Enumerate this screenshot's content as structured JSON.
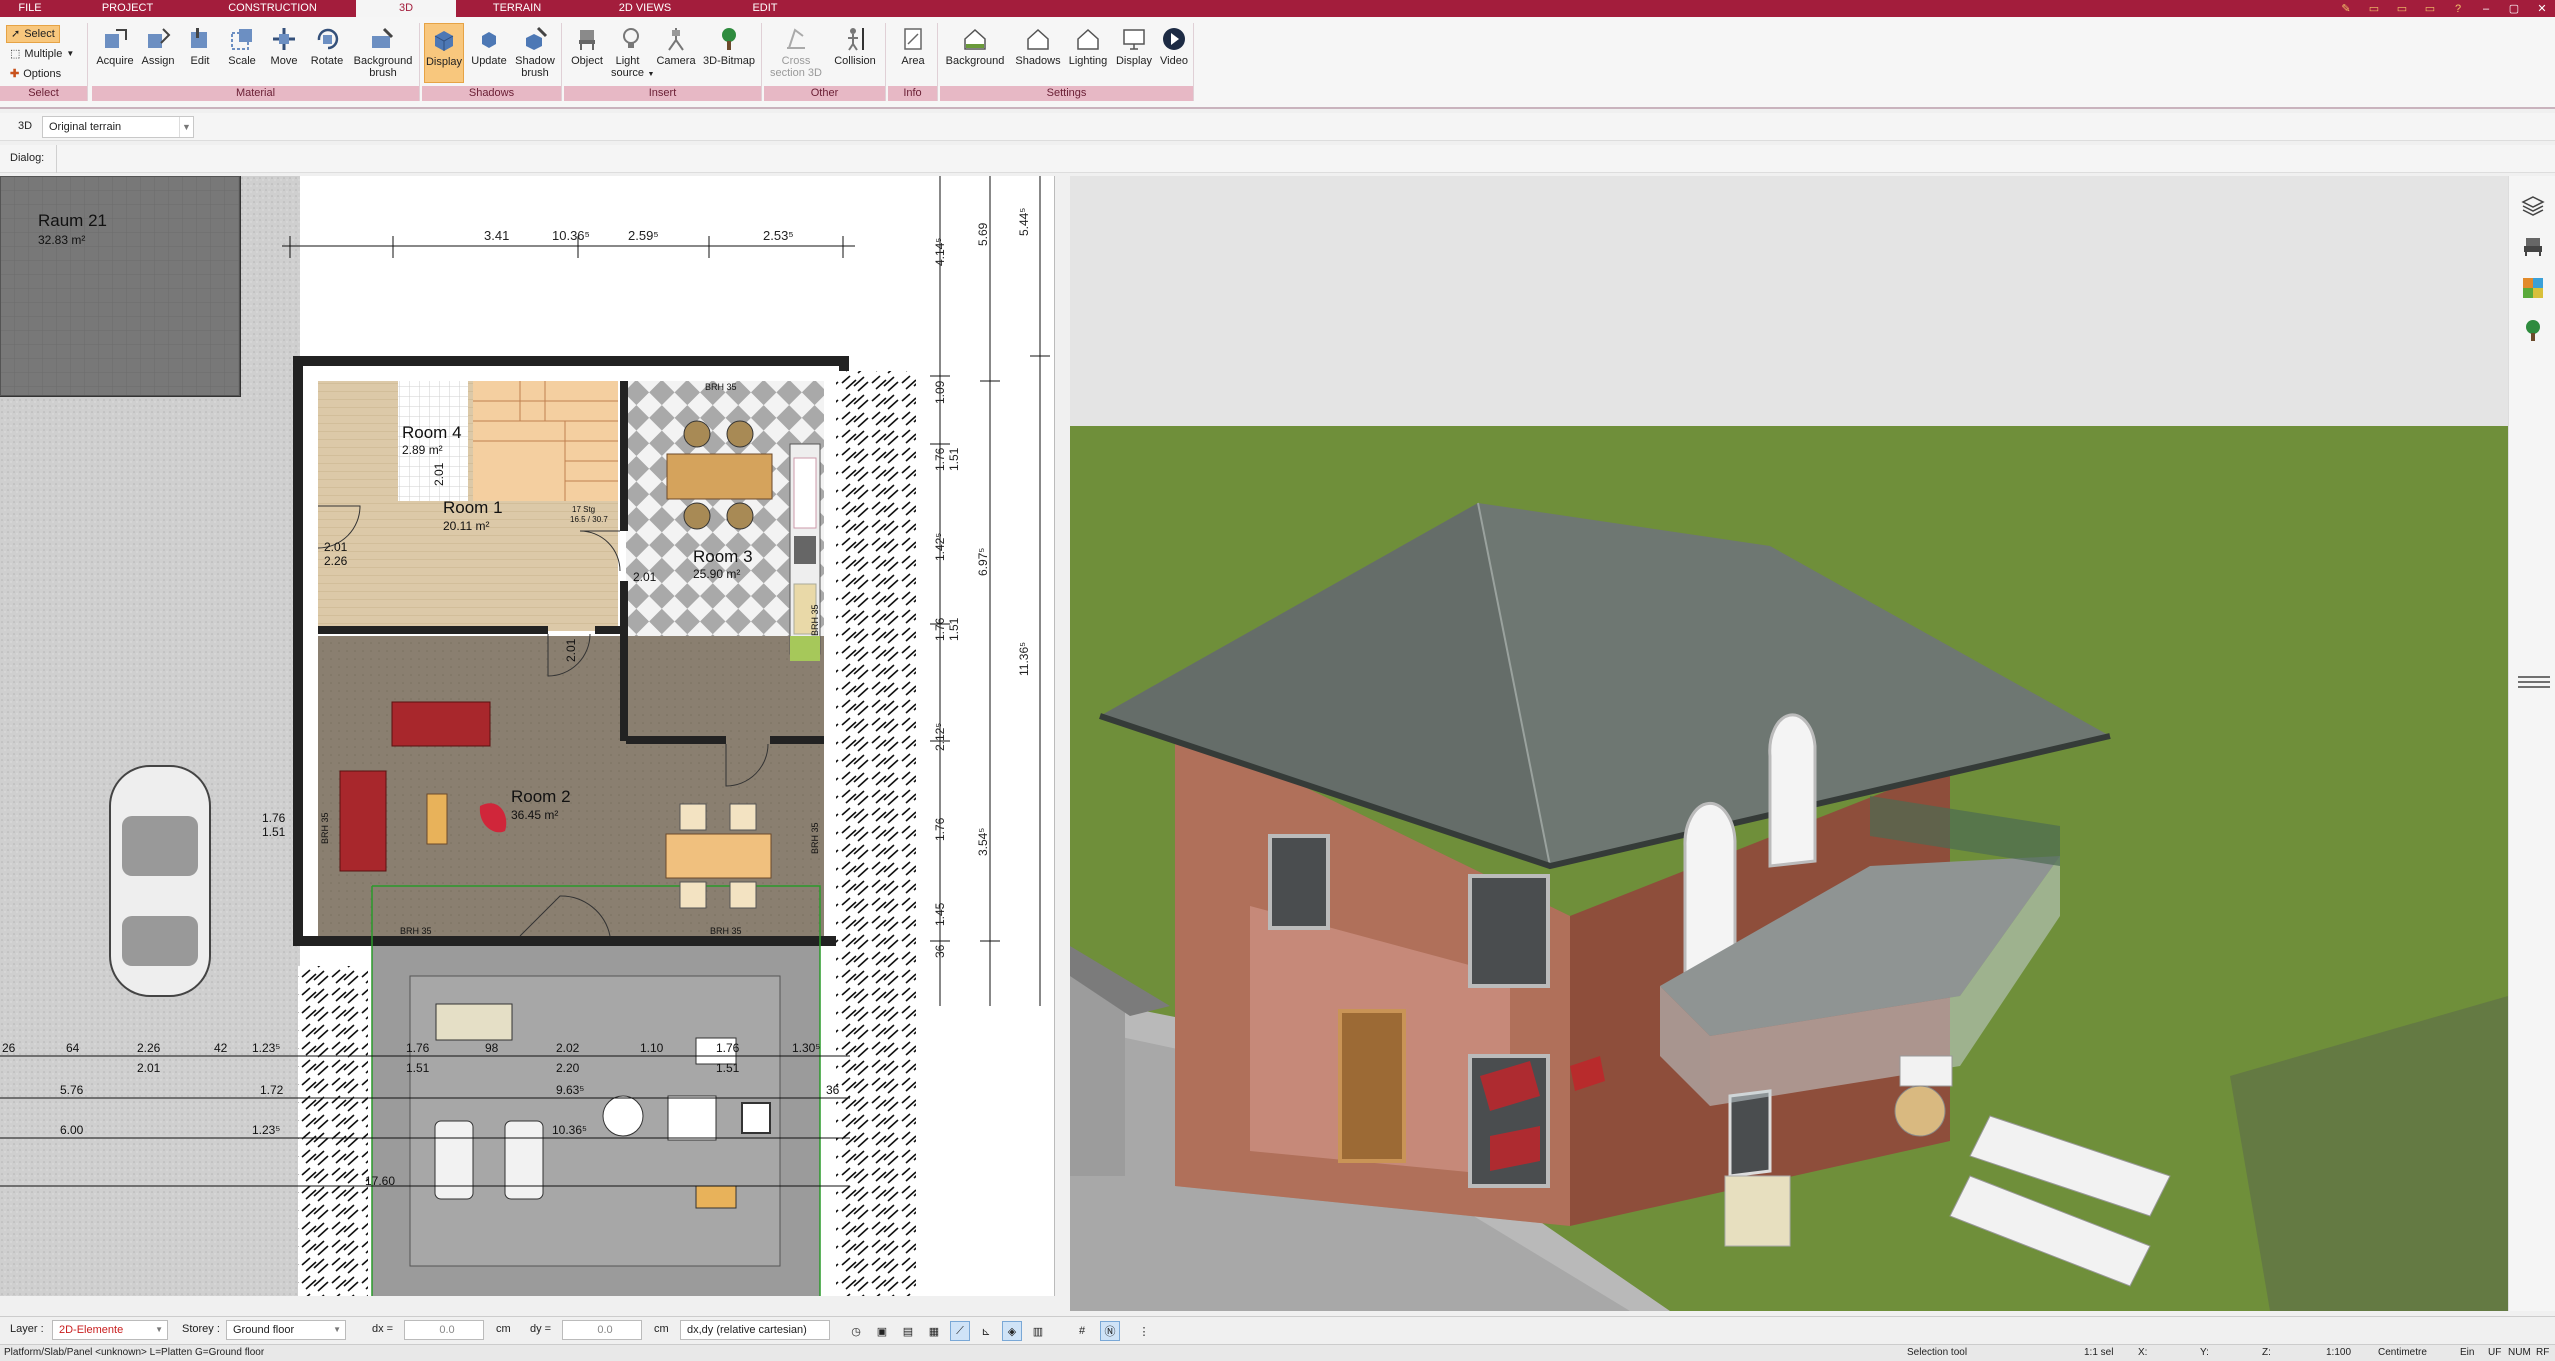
{
  "menu": {
    "tabs": [
      "FILE",
      "PROJECT",
      "CONSTRUCTION",
      "3D",
      "TERRAIN",
      "2D VIEWS",
      "EDIT"
    ],
    "active": "3D"
  },
  "ribbon": {
    "select_group": {
      "select": "Select",
      "multiple": "Multiple",
      "options": "Options",
      "label": "Select"
    },
    "material": {
      "label": "Material",
      "buttons": [
        "Acquire",
        "Assign",
        "Edit",
        "Scale",
        "Move",
        "Rotate",
        "Background brush"
      ]
    },
    "shadows": {
      "label": "Shadows",
      "buttons": [
        "Display",
        "Update",
        "Shadow brush"
      ]
    },
    "insert": {
      "label": "Insert",
      "buttons": [
        "Object",
        "Light source",
        "Camera",
        "3D-Bitmap"
      ]
    },
    "other": {
      "label": "Other",
      "buttons": [
        "Cross section 3D",
        "Collision"
      ]
    },
    "info": {
      "label": "Info",
      "buttons": [
        "Area"
      ]
    },
    "settings": {
      "label": "Settings",
      "buttons": [
        "Background",
        "Shadows",
        "Lighting",
        "Display",
        "Video"
      ]
    }
  },
  "subbar": {
    "mode": "3D",
    "terrain": "Original terrain"
  },
  "dialogbar": {
    "label": "Dialog:"
  },
  "plan": {
    "rooms": [
      {
        "name": "Raum 21",
        "area": "32.83 m²"
      },
      {
        "name": "Room 4",
        "area": "2.89 m²"
      },
      {
        "name": "Room 1",
        "area": "20.11 m²"
      },
      {
        "name": "Room 3",
        "area": "25.90 m²"
      },
      {
        "name": "Room 2",
        "area": "36.45 m²"
      }
    ],
    "top_dims": [
      "3.41",
      "10.36⁵",
      "2.59⁵",
      "2.53⁵"
    ],
    "right_dims": [
      "5.69",
      "5.44⁵",
      "4.14⁵",
      "1.09",
      "1.76",
      "1.51",
      "1.42⁵",
      "6.97⁵",
      "1.76",
      "1.51",
      "11.36⁵",
      "2.12⁵",
      "1.76",
      "3.54⁵",
      "1.45",
      "36"
    ],
    "left_dims": [
      "2.01",
      "2.26",
      "1.76",
      "1.51",
      "2.01",
      "2.01",
      "2.01"
    ],
    "bottom_dims": [
      "26",
      "64",
      "2.26",
      "2.01",
      "42",
      "1.23⁵",
      "5.76",
      "1.72",
      "6.00",
      "1.23⁵",
      "1.76",
      "1.51",
      "98",
      "2.02",
      "2.20",
      "1.10",
      "1.76",
      "1.51",
      "1.30⁵",
      "9.63⁵",
      "10.36⁵",
      "36",
      "17.60"
    ],
    "brh": [
      "BRH 35",
      "BRH 35",
      "BRH 35",
      "BRH 35",
      "BRH 35",
      "BRH 35"
    ],
    "stair": [
      "17 Stg",
      "16.5 / 30.7"
    ]
  },
  "bottombar": {
    "layer_label": "Layer :",
    "layer_value": "2D-Elemente",
    "storey_label": "Storey :",
    "storey_value": "Ground floor",
    "dx_label": "dx =",
    "dx_value": "0.0",
    "dx_unit": "cm",
    "dy_label": "dy =",
    "dy_value": "0.0",
    "dy_unit": "cm",
    "coord_mode": "dx,dy (relative cartesian)"
  },
  "status": {
    "hint": "Platform/Slab/Panel <unknown> L=Platten G=Ground floor",
    "tool": "Selection tool",
    "sel": "1:1 sel",
    "x": "X:",
    "y": "Y:",
    "z": "Z:",
    "scale": "1:100",
    "unit": "Centimetre",
    "ein": "Ein",
    "uf": "UF",
    "num": "NUM",
    "rf": "RF"
  },
  "colors": {
    "menubar": "#a31d3c",
    "group_label": "#e7b8c5",
    "active_button": "#f8c77d",
    "grass": "#6f8f3a",
    "sky": "#e6e6e6",
    "roof": "#6e7772",
    "brick": "#9a5a45"
  }
}
